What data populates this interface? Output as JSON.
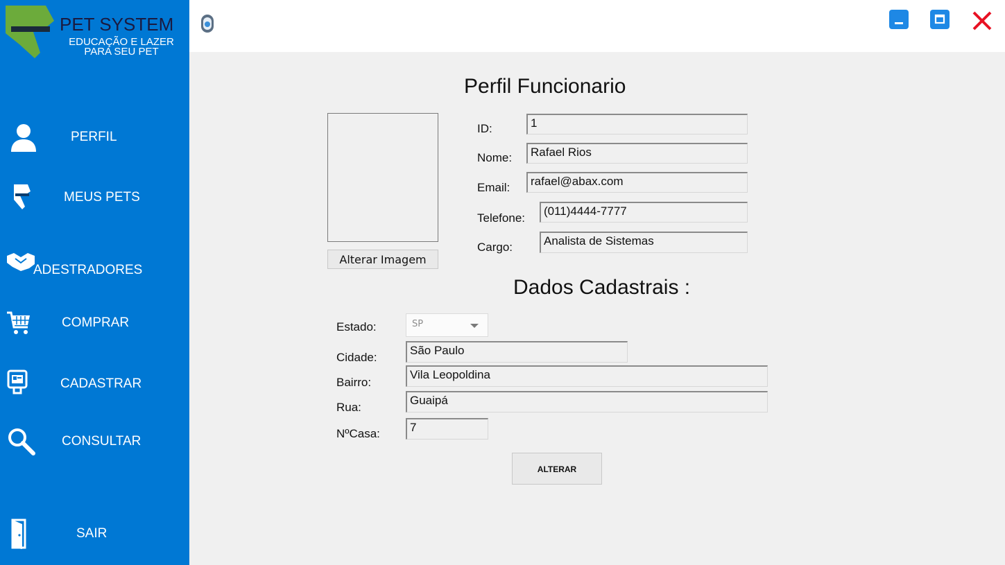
{
  "app": {
    "brand": "PET SYSTEM",
    "tagline_1": "EDUCAÇÃO E LAZER",
    "tagline_2": "PARA SEU PET"
  },
  "sidebar": {
    "items": [
      {
        "label": "PERFIL",
        "icon": "user-icon"
      },
      {
        "label": "MEUS PETS",
        "icon": "pet-icon"
      },
      {
        "label": "ADESTRADORES",
        "icon": "handshake-icon"
      },
      {
        "label": "COMPRAR",
        "icon": "cart-icon"
      },
      {
        "label": "CADASTRAR",
        "icon": "register-icon"
      },
      {
        "label": "CONSULTAR",
        "icon": "search-icon"
      },
      {
        "label": "SAIR",
        "icon": "door-icon"
      }
    ]
  },
  "window": {
    "buttons": [
      "minimize-icon",
      "maximize-icon",
      "close-icon"
    ],
    "accent": "#0078d4",
    "close_color": "#e81123"
  },
  "profile": {
    "title": "Perfil Funcionario",
    "change_image_label": "Alterar Imagem",
    "fields": {
      "id": {
        "label": "ID:",
        "value": "1"
      },
      "nome": {
        "label": "Nome:",
        "value": "Rafael Rios"
      },
      "email": {
        "label": "Email:",
        "value": "rafael@abax.com"
      },
      "telefone": {
        "label": "Telefone:",
        "value": "(011)4444-7777"
      },
      "cargo": {
        "label": "Cargo:",
        "value": "Analista de Sistemas"
      }
    }
  },
  "registration": {
    "title": "Dados Cadastrais :",
    "estado": {
      "label": "Estado:",
      "value": "SP"
    },
    "cidade": {
      "label": "Cidade:",
      "value": "São Paulo"
    },
    "bairro": {
      "label": "Bairro:",
      "value": "Vila Leopoldina"
    },
    "rua": {
      "label": "Rua:",
      "value": "Guaipá"
    },
    "numero": {
      "label": "NºCasa:",
      "value": "7"
    },
    "submit_label": "ALTERAR"
  }
}
